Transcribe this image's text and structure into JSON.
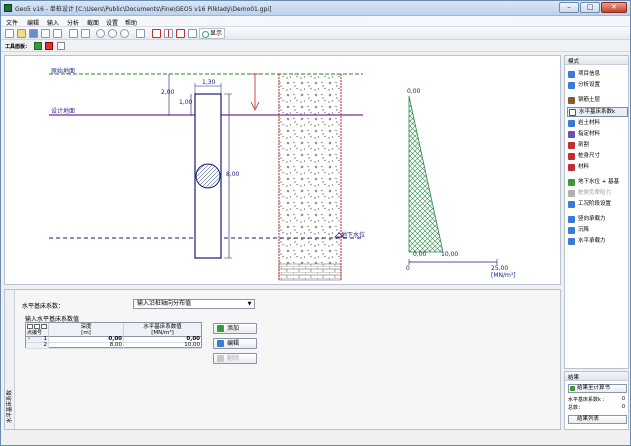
{
  "window": {
    "title": "Geo5 v16 - 单桩设计 [C:\\Users\\Public\\Documents\\Fine\\GEO5 v16 Pilkladý\\Demo01.gpi]",
    "minimize_glyph": "–",
    "maximize_glyph": "□",
    "close_glyph": "✕"
  },
  "menu": [
    "文件",
    "编辑",
    "输入",
    "分析",
    "截面",
    "设置",
    "帮助"
  ],
  "toolbar": {
    "show_label": "显示"
  },
  "toolbar2": {
    "label": "工具面板："
  },
  "drawing": {
    "ground_label": "原始地面",
    "design_label": "设计地面",
    "water_label": "地下水位",
    "dim_130": "1,30",
    "dim_200": "2,00",
    "dim_100": "1,00",
    "dim_800": "8,00",
    "k_top": "0,00",
    "k_bottom_left": "0,00",
    "k_bottom_right": "10,00",
    "axis_zero": "0",
    "axis_max": "25,00",
    "axis_unit": "[MN/m³]"
  },
  "sidebar": {
    "header": "模式",
    "items": [
      {
        "label": "项目信息",
        "color": "#3a7bd5"
      },
      {
        "label": "分析设置",
        "color": "#3a7bd5"
      },
      {
        "label": "钢筋土层",
        "color": "#8b5a2b"
      },
      {
        "label": "水平基床系数k",
        "color": "#555555"
      },
      {
        "label": "岩土材料",
        "color": "#3a7bd5"
      },
      {
        "label": "指定材料",
        "color": "#6a4fb5"
      },
      {
        "label": "剖割",
        "color": "#c03030"
      },
      {
        "label": "桩身尺寸",
        "color": "#c03030"
      },
      {
        "label": "材料",
        "color": "#c03030"
      },
      {
        "label": "地下水位 + 基基",
        "color": "#3a9a3a"
      },
      {
        "label": "桩侧负摩阻力",
        "color": "#b0b0b0"
      },
      {
        "label": "工况阶段设置",
        "color": "#3a7bd5"
      },
      {
        "label": "竖向承载力",
        "color": "#3a7bd5"
      },
      {
        "label": "沉降",
        "color": "#3a7bd5"
      },
      {
        "label": "水平承载力",
        "color": "#3a7bd5"
      }
    ]
  },
  "results": {
    "header": "结果",
    "add_button": "结果至计算书",
    "row1_label": "水平基床系数k ：",
    "row1_value": "0",
    "row2_label": "总数：",
    "row2_value": "0",
    "list_button": "结果列表"
  },
  "bottom": {
    "vtab_label": "水平基床系数",
    "field_label": "水平基床系数：",
    "select_value": "输入沿桩轴向分布值",
    "group_title": "输入水平基床系数值",
    "table": {
      "corner_label": "点编号",
      "col_depth": "深度",
      "col_depth_unit": "[m]",
      "col_k": "水平基床系数值",
      "col_k_unit": "[MN/m³]",
      "rows": [
        {
          "idx": "1",
          "depth": "0,00",
          "k": "0,00"
        },
        {
          "idx": "2",
          "depth": "8,00",
          "k": "10,00"
        }
      ]
    },
    "buttons": {
      "add": "添加",
      "edit": "编辑",
      "delete": "删除"
    }
  }
}
